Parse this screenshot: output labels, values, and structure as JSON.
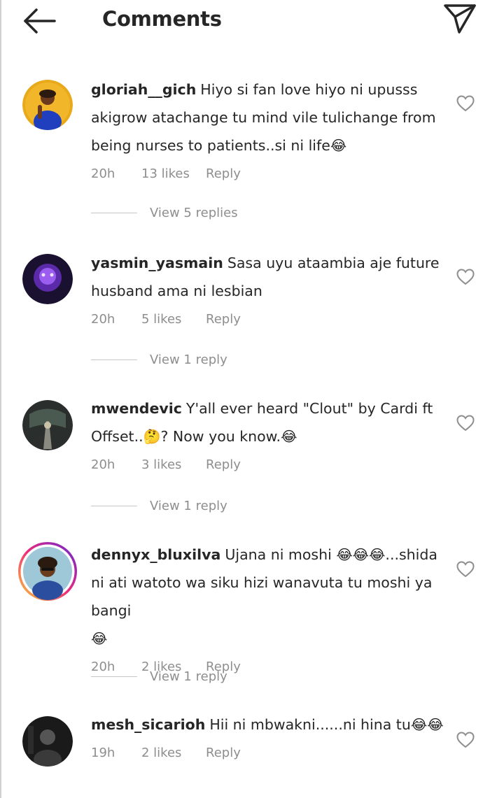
{
  "header": {
    "title": "Comments",
    "back_icon": "arrow-left-icon",
    "share_icon": "paper-plane-icon"
  },
  "comments": [
    {
      "username": "gloriah__gich",
      "text": "Hiyo si fan love hiyo ni upusss akigrow atachange tu mind vile tulichange from being nurses to patients..si ni life",
      "emoji": "😂",
      "time": "20h",
      "likes": "13 likes",
      "reply": "Reply",
      "view_replies": "View 5 replies"
    },
    {
      "username": "yasmin_yasmain",
      "text": "Sasa uyu ataambia aje future husband ama ni lesbian",
      "emoji": "",
      "time": "20h",
      "likes": "5 likes",
      "reply": "Reply",
      "view_replies": "View 1 reply"
    },
    {
      "username": "mwendevic",
      "text": "Y'all ever heard \"Clout\" by Cardi ft Offset..",
      "text2": "? Now you know.",
      "emoji_mid": "🤔",
      "emoji": "😂",
      "time": "20h",
      "likes": "3 likes",
      "reply": "Reply",
      "view_replies": "View 1 reply"
    },
    {
      "username": "dennyx_bluxilva",
      "text": "Ujana ni moshi ",
      "emoji_mid": "😂😂😂",
      "text2": "...shida ni ati watoto wa siku hizi wanavuta tu moshi ya bangi",
      "emoji": "😂",
      "time": "20h",
      "likes": "2 likes",
      "reply": "Reply",
      "view_replies": "View 1 reply"
    },
    {
      "username": "mesh_sicarioh",
      "text": "Hii ni mbwakni......ni hina tu",
      "emoji": "😂😂",
      "time": "19h",
      "likes": "2 likes",
      "reply": "Reply"
    }
  ],
  "colors": {
    "text": "#262626",
    "muted": "#8e8e8e",
    "story_ring_start": "#f9ce34",
    "story_ring_mid": "#ee2a7b",
    "story_ring_end": "#6228d7"
  }
}
